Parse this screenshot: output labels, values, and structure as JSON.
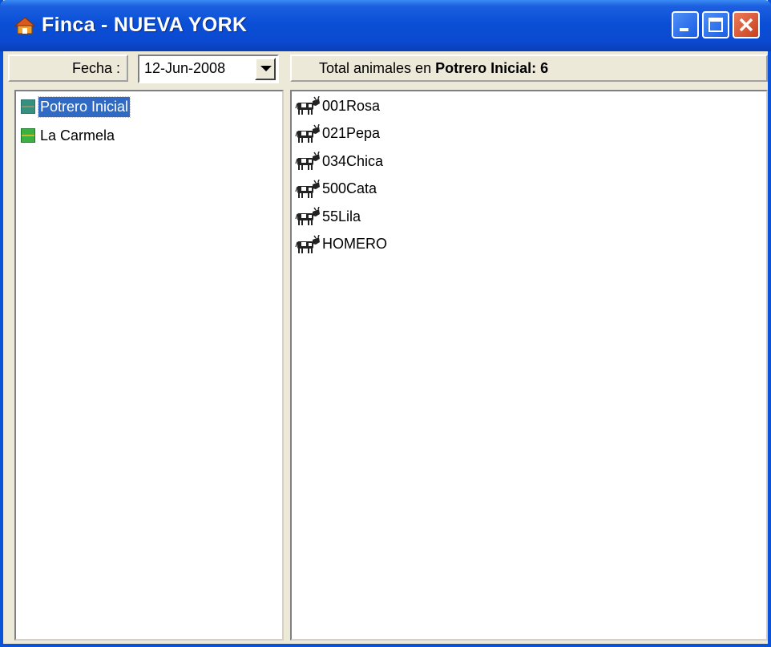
{
  "window": {
    "title": "Finca - NUEVA YORK",
    "title_color": "#0a4fd6"
  },
  "toolbar": {
    "fecha_label": "Fecha :",
    "date_value": "12-Jun-2008",
    "total_prefix": "Total animales en ",
    "total_bold": "Potrero Inicial: 6"
  },
  "potreros": [
    {
      "label": "Potrero Inicial",
      "selected": true,
      "icon": "potrero-icon"
    },
    {
      "label": "La Carmela",
      "selected": false,
      "icon": "potrero-icon"
    }
  ],
  "animals": [
    {
      "label": "001Rosa",
      "icon": "cow-icon"
    },
    {
      "label": "021Pepa",
      "icon": "cow-icon"
    },
    {
      "label": "034Chica",
      "icon": "cow-icon"
    },
    {
      "label": "500Cata",
      "icon": "cow-icon"
    },
    {
      "label": "55Lila",
      "icon": "cow-icon"
    },
    {
      "label": "HOMERO",
      "icon": "cow-icon"
    }
  ],
  "colors": {
    "selection": "#316ac5",
    "potrero_green": "#3cb043"
  }
}
